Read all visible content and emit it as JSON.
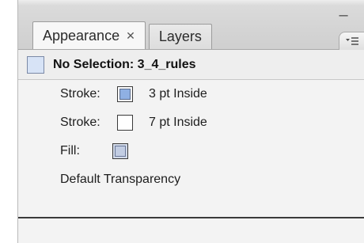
{
  "tabs": [
    {
      "label": "Appearance",
      "closable": true,
      "active": true
    },
    {
      "label": "Layers",
      "closable": false,
      "active": false
    }
  ],
  "header": {
    "label": "No Selection: 3_4_rules"
  },
  "rows": [
    {
      "label": "Stroke:",
      "value": "3 pt Inside",
      "swatch": "blue-outline"
    },
    {
      "label": "Stroke:",
      "value": "7 pt Inside",
      "swatch": "white"
    },
    {
      "label": "Fill:",
      "value": "",
      "swatch": "light-blue"
    },
    {
      "label": "Default Transparency"
    }
  ],
  "icons": {
    "collapse": "minus-icon",
    "close": "close-icon",
    "panel_menu": "menu-icon"
  },
  "colors": {
    "panel_bg": "#f3f3f3",
    "strip_bg": "#d3d3d3",
    "swatch_blue": "#8fb0e3",
    "swatch_light": "#d2dae9"
  }
}
